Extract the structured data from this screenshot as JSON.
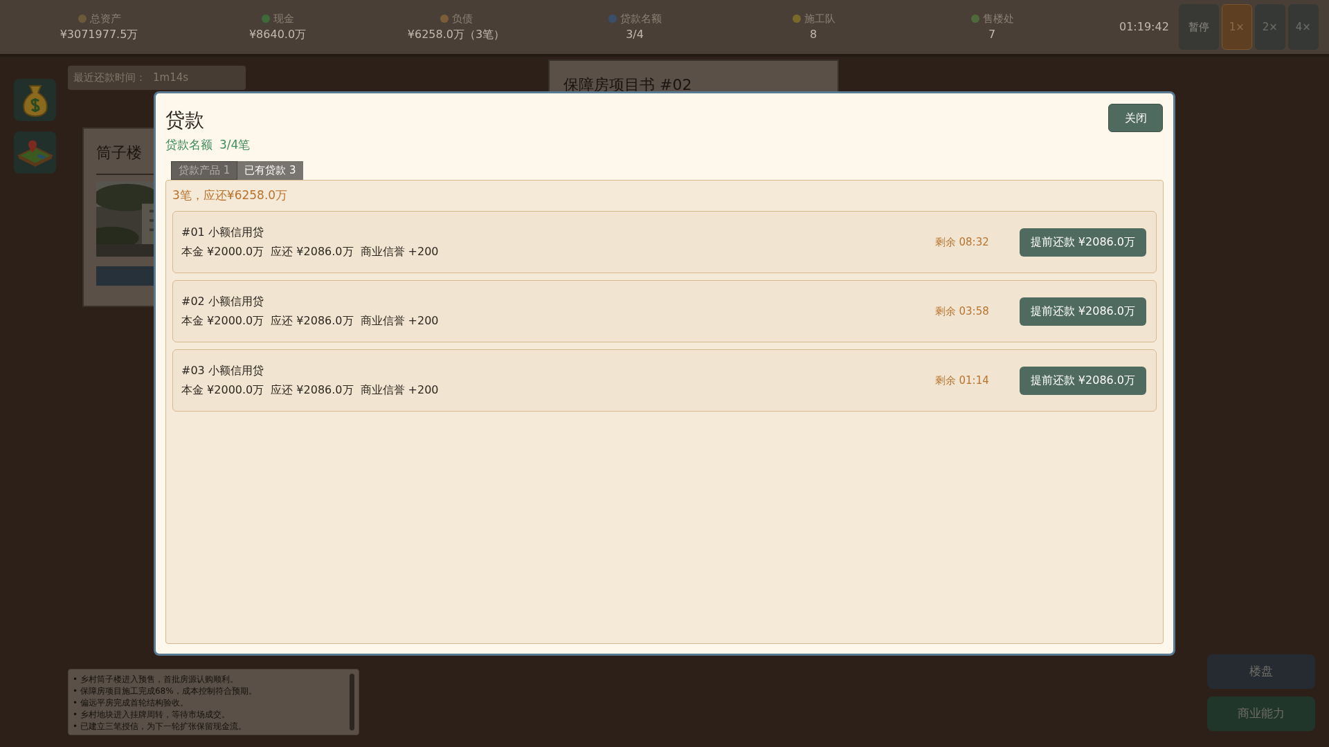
{
  "top_bar": {
    "stats": [
      {
        "label": "总资产",
        "value": "¥3071977.5万"
      },
      {
        "label": "现金",
        "value": "¥8640.0万"
      },
      {
        "label": "负债",
        "value": "¥6258.0万（3笔）"
      },
      {
        "label": "贷款名额",
        "value": "3/4"
      },
      {
        "label": "施工队",
        "value": "8"
      },
      {
        "label": "售楼处",
        "value": "7"
      }
    ],
    "clock": "01:19:42",
    "controls": [
      {
        "label": "暂停",
        "kind": "pause",
        "selected": false
      },
      {
        "label": "1×",
        "kind": "speed",
        "selected": true
      },
      {
        "label": "2×",
        "kind": "speed",
        "selected": false
      },
      {
        "label": "4×",
        "kind": "speed",
        "selected": false
      }
    ]
  },
  "notice": {
    "label": "最近还款时间：",
    "value": "1m14s"
  },
  "project_card": {
    "title": "保障房项目书 #02"
  },
  "listing_card": {
    "title": "筒子楼"
  },
  "log": [
    "• 乡村筒子楼进入预售，首批房源认购顺利。",
    "• 保障房项目施工完成68%，成本控制符合预期。",
    "• 偏远平房完成首轮结构验收。",
    "• 乡村地块进入挂牌周转，等待市场成交。",
    "• 已建立三笔授信，为下一轮扩张保留现金流。"
  ],
  "side_buttons": [
    {
      "label": "楼盘",
      "kind": "slate"
    },
    {
      "label": "商业能力",
      "kind": "green"
    }
  ],
  "modal": {
    "title": "贷款",
    "close": "关闭",
    "quota_label": "贷款名额",
    "quota_value": "3/4笔",
    "tabs": [
      {
        "label": "贷款产品 1",
        "selected": false
      },
      {
        "label": "已有贷款 3",
        "selected": true
      }
    ],
    "summary": "3笔，应还¥6258.0万",
    "loans": [
      {
        "name": "#01 小额信用贷",
        "principal": "本金 ¥2000.0万",
        "due": "应还 ¥2086.0万",
        "credit": "商业信誉 +200",
        "remaining": "剩余 08:32",
        "action": "提前还款 ¥2086.0万"
      },
      {
        "name": "#02 小额信用贷",
        "principal": "本金 ¥2000.0万",
        "due": "应还 ¥2086.0万",
        "credit": "商业信誉 +200",
        "remaining": "剩余 03:58",
        "action": "提前还款 ¥2086.0万"
      },
      {
        "name": "#03 小额信用贷",
        "principal": "本金 ¥2000.0万",
        "due": "应还 ¥2086.0万",
        "credit": "商业信誉 +200",
        "remaining": "剩余 01:14",
        "action": "提前还款 ¥2086.0万"
      }
    ]
  }
}
